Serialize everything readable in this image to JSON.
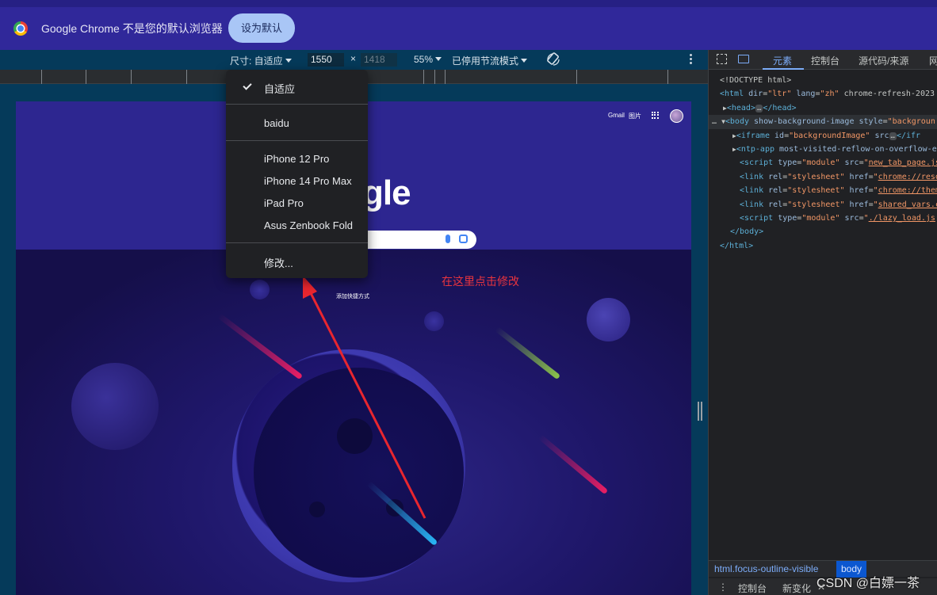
{
  "infobar": {
    "message": "Google Chrome 不是您的默认浏览器",
    "set_default_label": "设为默认"
  },
  "device_toolbar": {
    "dimensions_label": "尺寸: 自适应",
    "width_value": "1550",
    "times": "×",
    "height_value": "1418",
    "zoom_label": "55%",
    "throttle_label": "已停用节流模式"
  },
  "dimensions_menu": {
    "items": [
      {
        "label": "自适应",
        "checked": true
      },
      {
        "label": "baidu"
      },
      {
        "label": "iPhone 12 Pro"
      },
      {
        "label": "iPhone 14 Pro Max"
      },
      {
        "label": "iPad Pro"
      },
      {
        "label": "Asus Zenbook Fold"
      },
      {
        "label": "修改..."
      }
    ]
  },
  "page": {
    "gmail": "Gmail",
    "images": "图片",
    "logo_partial": "gle",
    "add_shortcut": "添加快捷方式"
  },
  "annotation": {
    "text": "在这里点击修改",
    "color": "#e8343e"
  },
  "devtools": {
    "tabs": [
      "元素",
      "控制台",
      "源代码/来源",
      "网"
    ],
    "active_tab": "元素",
    "code": {
      "doctype": "<!DOCTYPE html>",
      "html_open": "<html",
      "html_attrs": [
        {
          "name": "dir",
          "value": "\"ltr\""
        },
        {
          "name": "lang",
          "value": "\"zh\""
        }
      ],
      "html_tail": "chrome-refresh-2023",
      "head": "<head>",
      "head_close": "</head>",
      "body_open": "<body",
      "body_attr1": "show-background-image",
      "body_attr2": "style",
      "body_val2": "\"backgroun",
      "iframe": "<iframe",
      "iframe_attr_id": "id",
      "iframe_id_val": "\"backgroundImage\"",
      "iframe_attr_src": "src",
      "iframe_close": "</ifr",
      "ntp_app": "<ntp-app",
      "ntp_tail": "most-visited-reflow-on-overflow-e",
      "script1": "<script",
      "script1_attr": "type",
      "script1_type": "\"module\"",
      "script1_src_attr": "src",
      "script1_src": "new_tab_page.js",
      "link1_rel": "\"stylesheet\"",
      "link1_href": "chrome://reso",
      "link2_href": "chrome://them",
      "link3_href": "shared_vars.c",
      "script2_src": "./lazy_load.js",
      "body_close": "</body>",
      "html_close": "</html>",
      "link_tag": "<link",
      "rel_attr": "rel",
      "href_attr": "href",
      "ellipsis": "…",
      "eq": "="
    },
    "breadcrumbs": [
      "html.focus-outline-visible",
      "body"
    ],
    "drawer_tabs": [
      "控制台",
      "新变化"
    ]
  },
  "watermark": "CSDN @白嫖一茶"
}
